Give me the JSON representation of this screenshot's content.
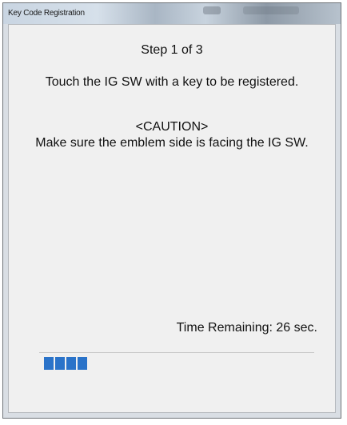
{
  "window": {
    "title": "Key Code Registration"
  },
  "content": {
    "step": "Step  1 of 3",
    "instruction": "Touch the IG SW with a key to be registered.",
    "caution_title": "<CAUTION>",
    "caution_text": "Make sure the emblem side is facing the IG SW."
  },
  "status": {
    "time_remaining_label": "Time Remaining:  26 sec.",
    "progress_fraction": 0.16
  },
  "colors": {
    "progress": "#2a73c9",
    "background": "#f0f0f0"
  }
}
